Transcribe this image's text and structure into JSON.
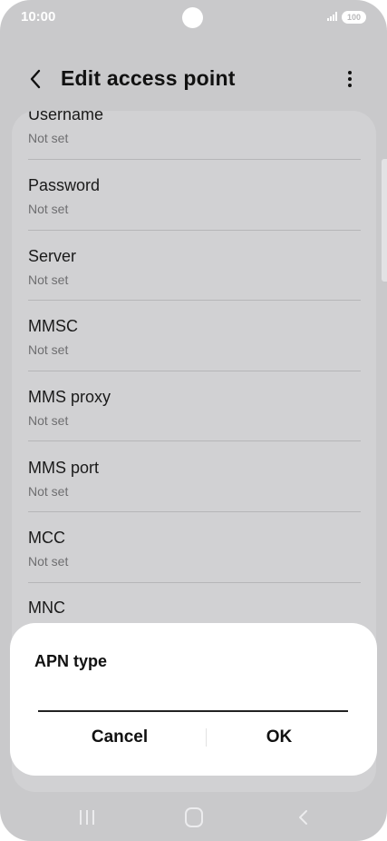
{
  "status_bar": {
    "time": "10:00",
    "battery": "100"
  },
  "header": {
    "title": "Edit access point"
  },
  "list": {
    "items": [
      {
        "label": "Username",
        "value": "Not set"
      },
      {
        "label": "Password",
        "value": "Not set"
      },
      {
        "label": "Server",
        "value": "Not set"
      },
      {
        "label": "MMSC",
        "value": "Not set"
      },
      {
        "label": "MMS proxy",
        "value": "Not set"
      },
      {
        "label": "MMS port",
        "value": "Not set"
      },
      {
        "label": "MCC",
        "value": "Not set"
      },
      {
        "label": "MNC",
        "value": ""
      }
    ]
  },
  "dialog": {
    "title": "APN type",
    "input_value": "",
    "cancel_label": "Cancel",
    "ok_label": "OK"
  },
  "icons": {
    "back": "back-arrow-icon",
    "more": "more-options-icon",
    "nav_recent": "recent-apps-icon",
    "nav_home": "home-icon",
    "nav_back": "nav-back-icon"
  },
  "colors": {
    "background": "#c9c9cb",
    "card": "#d1d1d3",
    "dialog": "#ffffff",
    "text": "#111111"
  }
}
